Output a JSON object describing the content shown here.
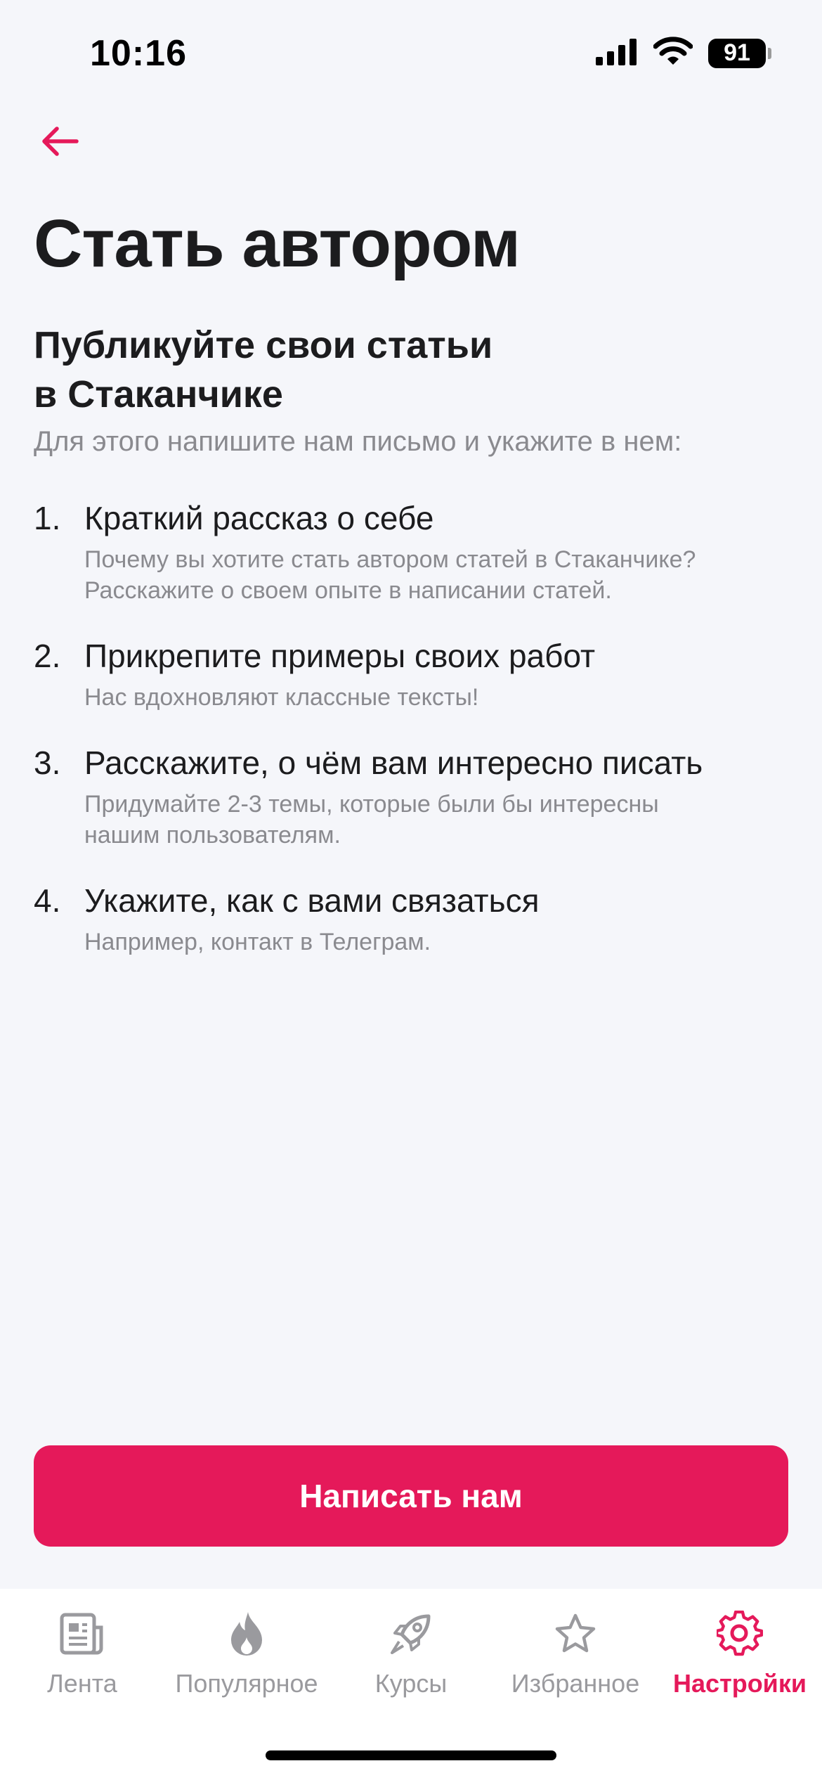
{
  "status_bar": {
    "time": "10:16",
    "battery": "91",
    "icons": [
      "cellular-signal-icon",
      "wifi-icon",
      "battery-icon"
    ]
  },
  "header": {
    "back_icon": "arrow-left-icon",
    "title": "Стать автором"
  },
  "content": {
    "subtitle_line1": "Публикуйте свои статьи",
    "subtitle_line2": "в Стаканчике",
    "intro": "Для этого напишите нам письмо и укажите в нем:",
    "steps": [
      {
        "number": "1.",
        "title": "Краткий рассказ о себе",
        "desc_line1": "Почему вы хотите стать автором статей в Стаканчике?",
        "desc_line2": "Расскажите о своем опыте в написании статей."
      },
      {
        "number": "2.",
        "title": "Прикрепите примеры своих работ",
        "desc_line1": "Нас вдохновляют классные тексты!"
      },
      {
        "number": "3.",
        "title": "Расскажите, о чём вам интересно писать",
        "desc_line1": "Придумайте 2-3 темы, которые были бы интересны",
        "desc_line2": "нашим пользователям."
      },
      {
        "number": "4.",
        "title": "Укажите, как с вами связаться",
        "desc_line1": "Например, контакт в Телеграм."
      }
    ]
  },
  "cta": {
    "label": "Написать нам"
  },
  "colors": {
    "accent": "#e5195a",
    "background": "#f5f6fa",
    "muted": "#8a8a8f",
    "inactive_tab": "#9a9a9e"
  },
  "tab_bar": {
    "tabs": [
      {
        "label": "Лента",
        "icon": "news-icon",
        "active": false
      },
      {
        "label": "Популярное",
        "icon": "flame-icon",
        "active": false
      },
      {
        "label": "Курсы",
        "icon": "rocket-icon",
        "active": false
      },
      {
        "label": "Избранное",
        "icon": "star-icon",
        "active": false
      },
      {
        "label": "Настройки",
        "icon": "gear-icon",
        "active": true
      }
    ]
  }
}
